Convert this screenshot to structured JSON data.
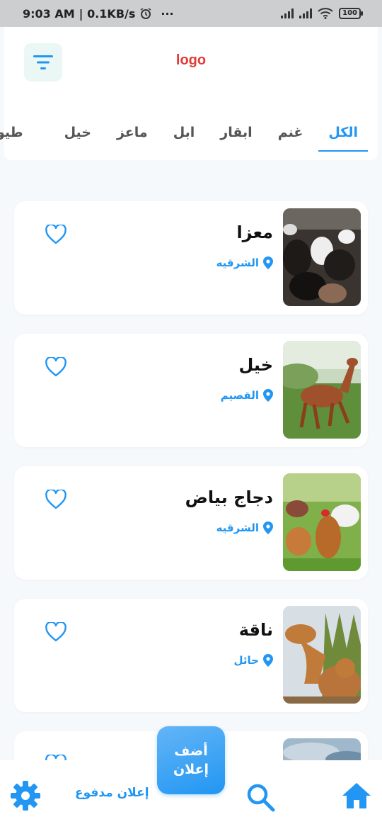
{
  "status_bar": {
    "time": "9:03 AM",
    "speed": "| 0.1KB/s",
    "dots": "···",
    "battery": "100"
  },
  "header": {
    "logo_text": "logo",
    "filter_icon": "filter-icon"
  },
  "tabs": [
    {
      "label": "الكل",
      "active": true
    },
    {
      "label": "غنم",
      "active": false
    },
    {
      "label": "ابقار",
      "active": false
    },
    {
      "label": "ابل",
      "active": false
    },
    {
      "label": "ماعز",
      "active": false
    },
    {
      "label": "خيل",
      "active": false
    },
    {
      "label": "طيور",
      "active": false
    }
  ],
  "listings": [
    {
      "title": "معزا",
      "location": "الشرقيه",
      "image": "goats"
    },
    {
      "title": "خيل",
      "location": "القصيم",
      "image": "horse"
    },
    {
      "title": "دجاج بياض",
      "location": "الشرقيه",
      "image": "chickens"
    },
    {
      "title": "ناقة",
      "location": "حائل",
      "image": "camel"
    },
    {
      "title": "",
      "location": "",
      "image": "sky"
    }
  ],
  "bottom_nav": {
    "paid_ad_label": "إعلان مدفوع",
    "add_line1": "أضف",
    "add_line2": "إعلان"
  },
  "colors": {
    "accent": "#2196f3",
    "logo": "#e53935",
    "background": "#f6f9fc"
  }
}
